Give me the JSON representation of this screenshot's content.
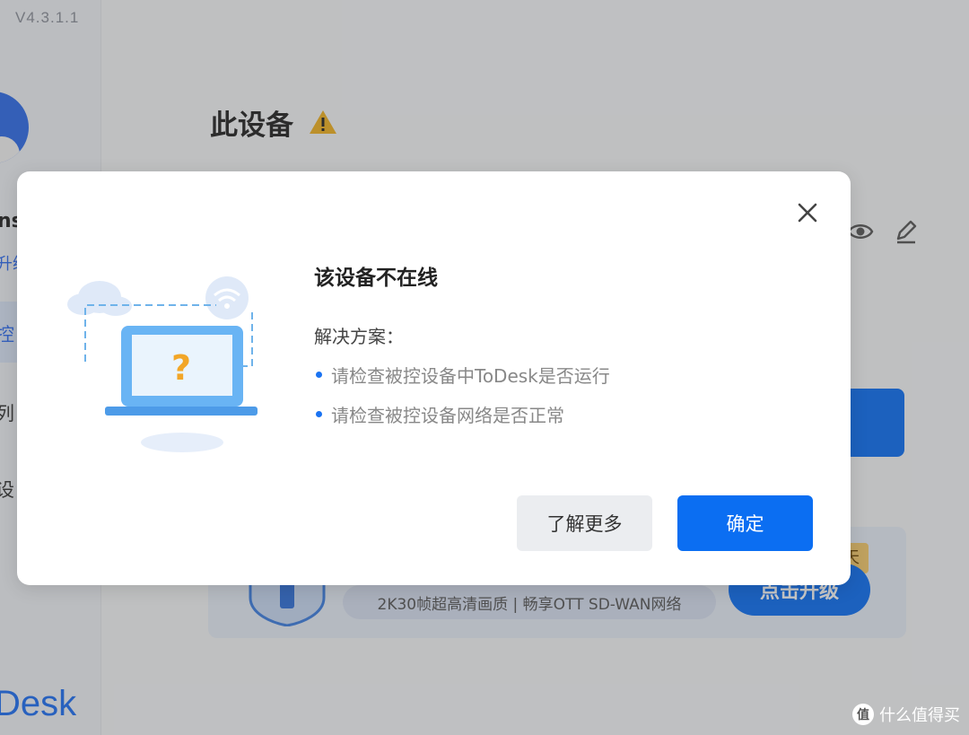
{
  "app": {
    "version": "V4.3.1.1",
    "user_name_fragment": "ns",
    "user_link_fragment": "升级",
    "nav": [
      {
        "label": "控"
      },
      {
        "label": "列"
      },
      {
        "label": "设"
      }
    ],
    "brand_fragment": "Desk"
  },
  "main": {
    "title": "此设备"
  },
  "promo": {
    "features": "2K30帧超高清画质 | 畅享OTT SD-WAN网络",
    "upgrade_label": "点击升级",
    "badge_fragment": "天"
  },
  "dialog": {
    "title": "该设备不在线",
    "solution_label": "解决方案：",
    "bullets": [
      "请检查被控设备中ToDesk是否运行",
      "请检查被控设备网络是否正常"
    ],
    "learn_more_label": "了解更多",
    "confirm_label": "确定"
  },
  "watermark": {
    "icon_char": "值",
    "text": "什么值得买"
  },
  "colors": {
    "accent": "#0b6ef2",
    "warning": "#f0b020"
  }
}
